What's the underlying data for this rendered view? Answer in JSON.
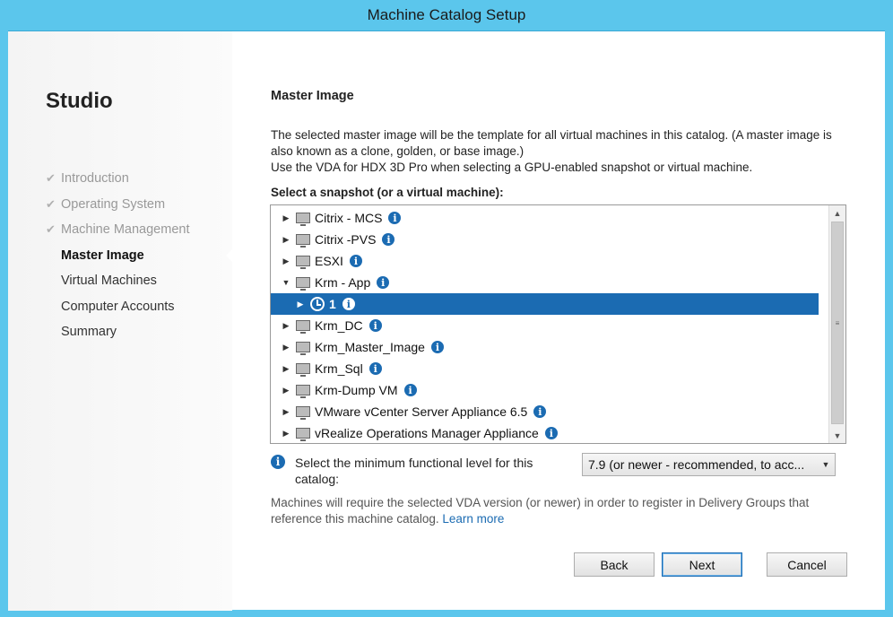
{
  "window": {
    "title": "Machine Catalog Setup"
  },
  "sidebar": {
    "title": "Studio",
    "steps": [
      {
        "label": "Introduction",
        "state": "done"
      },
      {
        "label": "Operating System",
        "state": "done"
      },
      {
        "label": "Machine Management",
        "state": "done"
      },
      {
        "label": "Master Image",
        "state": "current"
      },
      {
        "label": "Virtual Machines",
        "state": "pending"
      },
      {
        "label": "Computer Accounts",
        "state": "pending"
      },
      {
        "label": "Summary",
        "state": "pending"
      }
    ],
    "check_glyph": "✔"
  },
  "main": {
    "section_title": "Master Image",
    "description_line1": "The selected master image will be the template for all virtual machines in this catalog. (A master image is also known as a clone, golden, or base image.)",
    "description_line2": "Use the VDA for HDX 3D Pro when selecting a GPU-enabled snapshot or virtual machine.",
    "select_label": "Select a snapshot (or a virtual machine):",
    "tree": [
      {
        "label": "Citrix - MCS",
        "expanded": false,
        "type": "vm"
      },
      {
        "label": "Citrix -PVS",
        "expanded": false,
        "type": "vm"
      },
      {
        "label": "ESXI",
        "expanded": false,
        "type": "vm"
      },
      {
        "label": "Krm - App",
        "expanded": true,
        "type": "vm"
      },
      {
        "label": "1",
        "expanded": false,
        "type": "snapshot",
        "selected": true
      },
      {
        "label": "Krm_DC",
        "expanded": false,
        "type": "vm"
      },
      {
        "label": "Krm_Master_Image",
        "expanded": false,
        "type": "vm"
      },
      {
        "label": "Krm_Sql",
        "expanded": false,
        "type": "vm"
      },
      {
        "label": "Krm-Dump VM",
        "expanded": false,
        "type": "vm"
      },
      {
        "label": "VMware vCenter Server Appliance 6.5",
        "expanded": false,
        "type": "vm"
      },
      {
        "label": "vRealize Operations Manager Appliance",
        "expanded": false,
        "type": "vm"
      }
    ],
    "functional_level_label": "Select the minimum functional level for this catalog:",
    "functional_level_value": "7.9 (or newer - recommended, to acc...",
    "note_text": "Machines will require the selected VDA version (or newer) in order to register in Delivery Groups that reference this machine catalog.",
    "learn_more": "Learn more"
  },
  "buttons": {
    "back": "Back",
    "next": "Next",
    "cancel": "Cancel"
  },
  "colors": {
    "accent": "#1b6bb2",
    "titlebar": "#5bc6ec"
  }
}
